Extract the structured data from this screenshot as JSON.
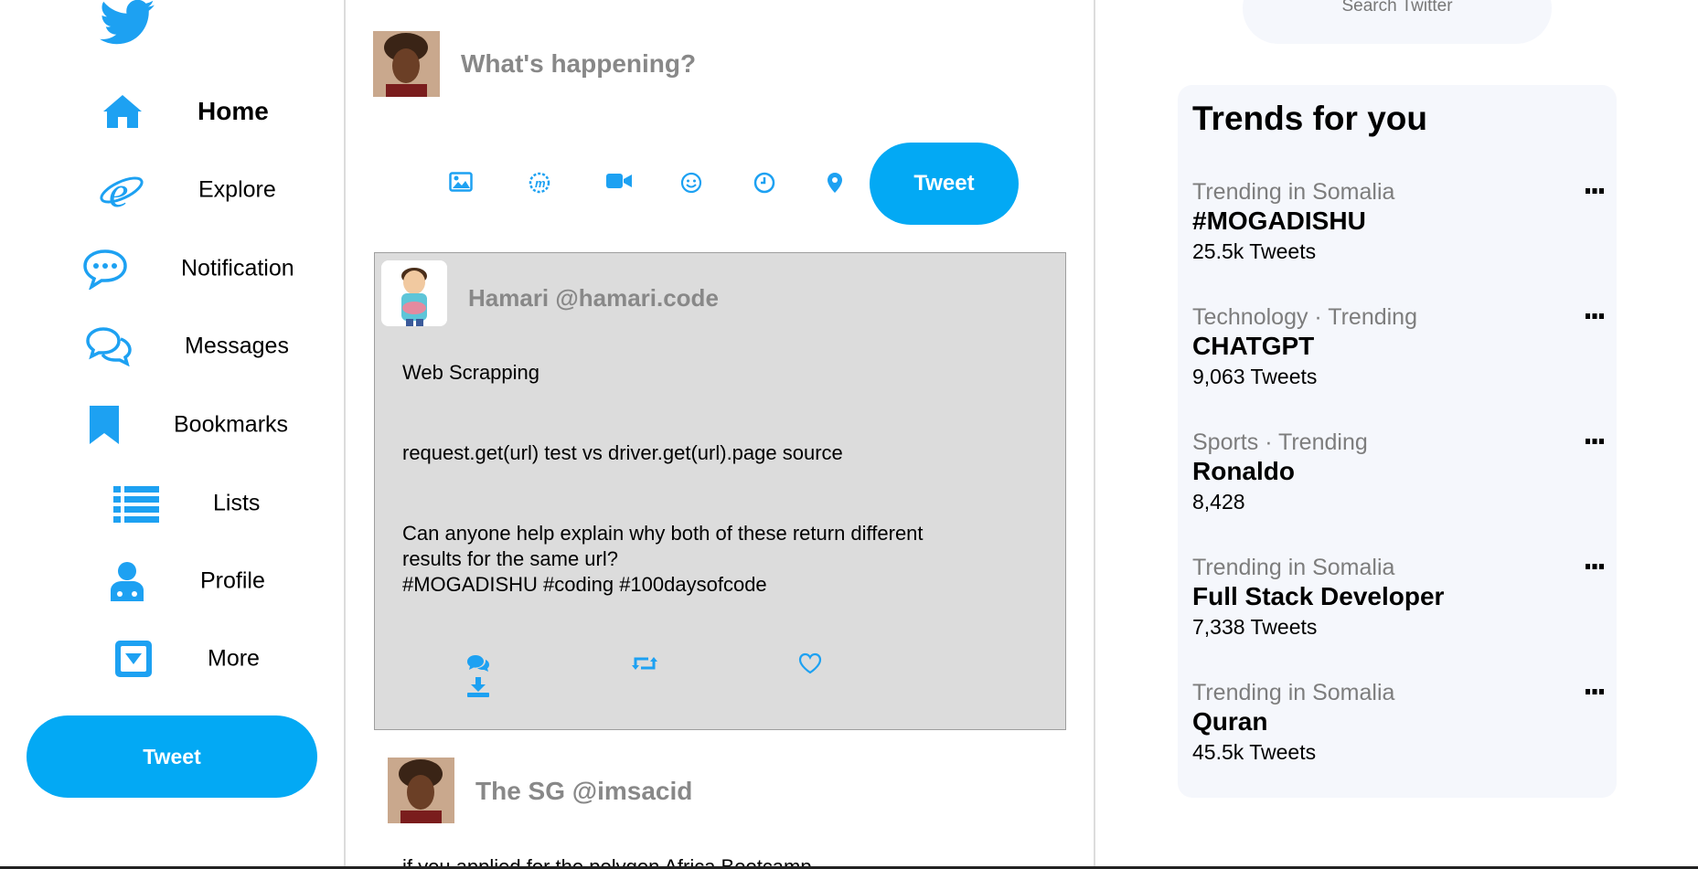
{
  "colors": {
    "brand": "#1da1f2",
    "button": "#03a9f4",
    "post_bg": "#dcdcdc",
    "panel_bg": "#f5f7fc"
  },
  "sidebar": {
    "logo": "twitter-bird-icon",
    "items": [
      {
        "label": "Home",
        "icon": "home-icon"
      },
      {
        "label": "Explore",
        "icon": "explore-icon"
      },
      {
        "label": "Notification",
        "icon": "chat-bubble-icon"
      },
      {
        "label": "Messages",
        "icon": "messages-icon"
      },
      {
        "label": "Bookmarks",
        "icon": "bookmark-icon"
      },
      {
        "label": "Lists",
        "icon": "list-icon"
      },
      {
        "label": "Profile",
        "icon": "user-icon"
      },
      {
        "label": "More",
        "icon": "caret-square-down-icon"
      }
    ],
    "tweet_label": "Tweet"
  },
  "composer": {
    "placeholder": "What's happening?",
    "tools": [
      "image-icon",
      "gif-icon",
      "video-icon",
      "emoji-icon",
      "schedule-icon",
      "location-icon"
    ],
    "tweet_label": "Tweet"
  },
  "posts": [
    {
      "author": "Hamari @hamari.code",
      "lines": [
        "Web Scrapping",
        "request.get(url) test vs driver.get(url).page source",
        "Can anyone help explain why both of these return different",
        "results for the same url?",
        "#MOGADISHU #coding #100daysofcode"
      ],
      "actions": [
        "reply-icon",
        "retweet-icon",
        "like-icon",
        "download-icon"
      ]
    },
    {
      "author": "The SG @imsacid",
      "text": "if you applied for the polygon Africa Bootcamp"
    }
  ],
  "search": {
    "placeholder": "Search Twitter"
  },
  "trends": {
    "title": "Trends for you",
    "items": [
      {
        "context": "Trending in Somalia",
        "name": "#MOGADISHU",
        "count": "25.5k Tweets"
      },
      {
        "context": "Technology · Trending",
        "name": "CHATGPT",
        "count": "9,063 Tweets"
      },
      {
        "context": "Sports · Trending",
        "name": "Ronaldo",
        "count": "8,428"
      },
      {
        "context": "Trending in Somalia",
        "name": "Full Stack Developer",
        "count": "7,338 Tweets"
      },
      {
        "context": "Trending in Somalia",
        "name": "Quran",
        "count": "45.5k Tweets"
      }
    ]
  }
}
